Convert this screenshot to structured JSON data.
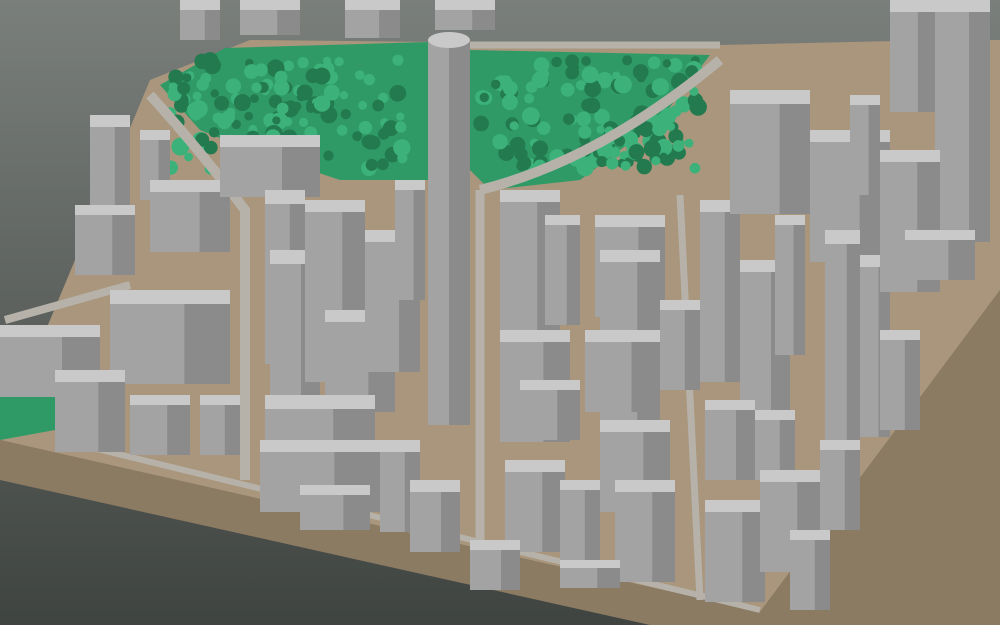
{
  "scene": {
    "name": "city-block-3d-model",
    "colors": {
      "background_top": "#7a7f7b",
      "background_bottom": "#3f4441",
      "ground": "#a9967c",
      "ground_side": "#8c7b63",
      "park_grass": "#2f9a66",
      "tree_dark": "#237a4f",
      "tree_light": "#3cb27a",
      "building_top": "#c9c9c9",
      "building_side": "#a3a3a3",
      "building_shade": "#8b8b8b",
      "road": "#b6b2aa"
    }
  }
}
